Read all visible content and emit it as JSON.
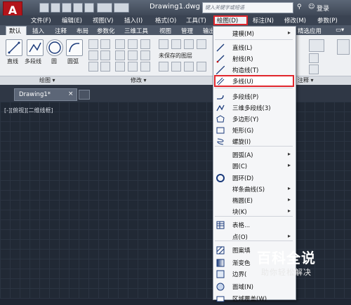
{
  "app": {
    "doc_title": "Drawing1.dwg",
    "search_placeholder": "键入关键字或短语",
    "login": "登录",
    "logo": "A"
  },
  "menubar": {
    "items": [
      "文件(F)",
      "编辑(E)",
      "视图(V)",
      "插入(I)",
      "格式(O)",
      "工具(T)",
      "绘图(D)",
      "标注(N)",
      "修改(M)",
      "参数(P)"
    ]
  },
  "ribbon": {
    "tabs": [
      "默认",
      "插入",
      "注释",
      "布局",
      "参数化",
      "三维工具",
      "视图",
      "管理",
      "输出"
    ],
    "extra_tab": "精选应用",
    "draw_tools": [
      "直线",
      "多段线",
      "圆",
      "圆弧"
    ],
    "unsaved_layer": "未保存的图层",
    "panel_draw": "绘图 ▾",
    "panel_modify": "修改 ▾",
    "panel_annotate": "注释 ▾"
  },
  "document": {
    "tab": "Drawing1*",
    "viewport_label": "[-][俯视][二维线框]"
  },
  "dropdown": {
    "items": [
      {
        "label": "建模(M)",
        "submenu": true,
        "icon": ""
      },
      {
        "label": "直线(L)",
        "submenu": false,
        "icon": "line-icon"
      },
      {
        "label": "射线(R)",
        "submenu": false,
        "icon": "ray-icon"
      },
      {
        "label": "构造线(T)",
        "submenu": false,
        "icon": "xline-icon"
      },
      {
        "label": "多线(U)",
        "submenu": false,
        "icon": "mline-icon"
      },
      {
        "label": "多段线(P)",
        "submenu": false,
        "icon": "pline-icon"
      },
      {
        "label": "三维多段线(3)",
        "submenu": false,
        "icon": "3dpoly-icon"
      },
      {
        "label": "多边形(Y)",
        "submenu": false,
        "icon": "polygon-icon"
      },
      {
        "label": "矩形(G)",
        "submenu": false,
        "icon": "rectangle-icon"
      },
      {
        "label": "螺旋(I)",
        "submenu": false,
        "icon": "helix-icon"
      },
      {
        "label": "圆弧(A)",
        "submenu": true,
        "icon": ""
      },
      {
        "label": "圆(C)",
        "submenu": true,
        "icon": ""
      },
      {
        "label": "圆环(D)",
        "submenu": false,
        "icon": "donut-icon"
      },
      {
        "label": "样条曲线(S)",
        "submenu": true,
        "icon": ""
      },
      {
        "label": "椭圆(E)",
        "submenu": true,
        "icon": ""
      },
      {
        "label": "块(K)",
        "submenu": true,
        "icon": ""
      },
      {
        "label": "表格...",
        "submenu": false,
        "icon": "table-icon"
      },
      {
        "label": "点(O)",
        "submenu": true,
        "icon": ""
      },
      {
        "label": "图案填",
        "submenu": false,
        "icon": "hatch-icon"
      },
      {
        "label": "渐变色",
        "submenu": false,
        "icon": "gradient-icon"
      },
      {
        "label": "边界(",
        "submenu": false,
        "icon": "boundary-icon"
      },
      {
        "label": "面域(N)",
        "submenu": false,
        "icon": "region-icon"
      },
      {
        "label": "区域覆盖(W)",
        "submenu": false,
        "icon": "wipeout-icon"
      }
    ],
    "highlighted": "多线(U)"
  },
  "watermark": {
    "title": "百科全说",
    "subtitle": "助你轻松解决"
  },
  "colors": {
    "accent_red": "#e0262c",
    "canvas": "#212935"
  }
}
